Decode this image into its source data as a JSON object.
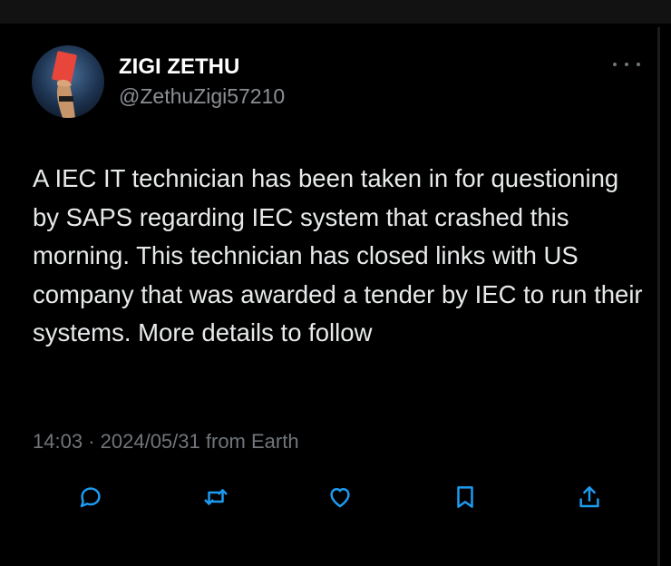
{
  "author": {
    "display_name": "ZIGI ZETHU",
    "handle": "@ZethuZigi57210",
    "avatar": "referee-red-card-avatar"
  },
  "tweet": {
    "text": "A IEC IT technician has been taken in for questioning by SAPS regarding IEC system that crashed this morning. This technician has closed links with US company that was awarded a tender by IEC to run their systems. More details to follow",
    "time": "14:03",
    "separator": "·",
    "date": "2024/05/31",
    "source": "from Earth"
  },
  "actions": [
    {
      "icon": "reply-icon"
    },
    {
      "icon": "retweet-icon"
    },
    {
      "icon": "like-icon"
    },
    {
      "icon": "bookmark-icon"
    },
    {
      "icon": "share-icon"
    }
  ],
  "colors": {
    "background": "#000000",
    "text": "#e7e9ea",
    "muted": "#71767b",
    "icon": "#1d9bf0"
  }
}
